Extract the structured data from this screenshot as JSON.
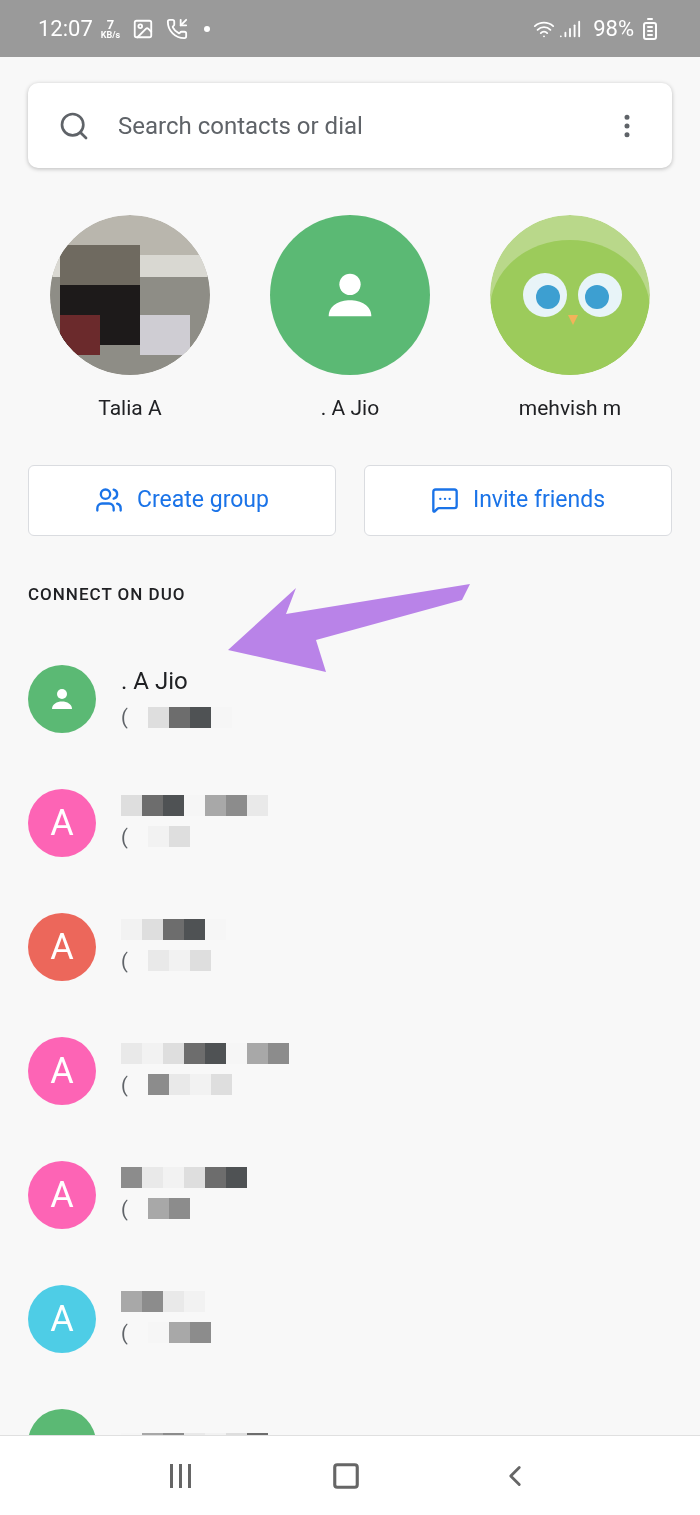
{
  "status_bar": {
    "time": "12:07",
    "speed_value": "7",
    "speed_unit": "KB/s",
    "battery": "98%"
  },
  "search": {
    "placeholder": "Search contacts or dial"
  },
  "favorites": [
    {
      "name": "Talia A",
      "kind": "picture"
    },
    {
      "name": ". A Jio",
      "kind": "person",
      "color": "#5bb974"
    },
    {
      "name": "mehvish m",
      "kind": "picture"
    }
  ],
  "actions": [
    {
      "label": "Create group",
      "kind": "group"
    },
    {
      "label": "Invite friends",
      "kind": "invite"
    }
  ],
  "section_title": "CONNECT ON DUO",
  "contacts": [
    {
      "kind": "person",
      "name": ". A Jio",
      "phone": "(",
      "color": "#5bb974"
    },
    {
      "kind": "letter",
      "initial": "A",
      "phone": "(",
      "color": "#fd64b5"
    },
    {
      "kind": "letter",
      "initial": "A",
      "phone": "(",
      "color": "#ec675b"
    },
    {
      "kind": "letter",
      "initial": "A",
      "phone": "(",
      "color": "#fd64b5"
    },
    {
      "kind": "letter",
      "initial": "A",
      "phone": "(",
      "color": "#fd64b5"
    },
    {
      "kind": "letter",
      "initial": "A",
      "phone": "(",
      "color": "#4ecde6"
    },
    {
      "kind": "letter",
      "color": "#5bb974"
    }
  ]
}
